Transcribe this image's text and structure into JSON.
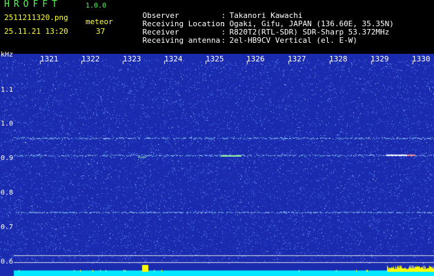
{
  "header": {
    "app_title": "HROFFT",
    "version": "1.0.0",
    "filename": "2511211320.png",
    "timestamp": "25.11.21 13:20",
    "meteor_label": "meteor",
    "meteor_count": "37"
  },
  "info": [
    {
      "label": "Observer",
      "sep": ":",
      "value": "Takanori Kawachi"
    },
    {
      "label": "Receiving Location",
      "sep": ":",
      "value": "Ogaki, Gifu, JAPAN (136.60E, 35.35N)"
    },
    {
      "label": "Receiver",
      "sep": ":",
      "value": "R820T2(RTL-SDR) SDR-Sharp 53.372MHz"
    },
    {
      "label": "Receiving antenna",
      "sep": ":",
      "value": "2el-HB9CV Vertical (el. E-W)"
    }
  ],
  "spectrogram": {
    "unit": "kHz",
    "time_ticks": [
      "1321",
      "1322",
      "1323",
      "1324",
      "1325",
      "1326",
      "1327",
      "1328",
      "1329",
      "1330"
    ],
    "freq_ticks": [
      "1.1",
      "1.0",
      "0.9",
      "0.8",
      "0.7",
      "0.6"
    ],
    "freq_range_khz": [
      0.58,
      1.16
    ],
    "background_color": "#1a2bb0",
    "noise_color": "#6fa2ff",
    "trace_color": "#8fe0ff",
    "bottom_bar_color": "#00e8ff",
    "burst_color": "#ffff00",
    "horizontal_traces_khz": [
      0.96,
      0.91,
      0.745
    ],
    "reference_lines_khz": [
      0.62,
      0.6
    ]
  },
  "colors": {
    "yellow_text": "#ffff33",
    "green_text": "#4cff4c",
    "white_text": "#ffffff"
  }
}
